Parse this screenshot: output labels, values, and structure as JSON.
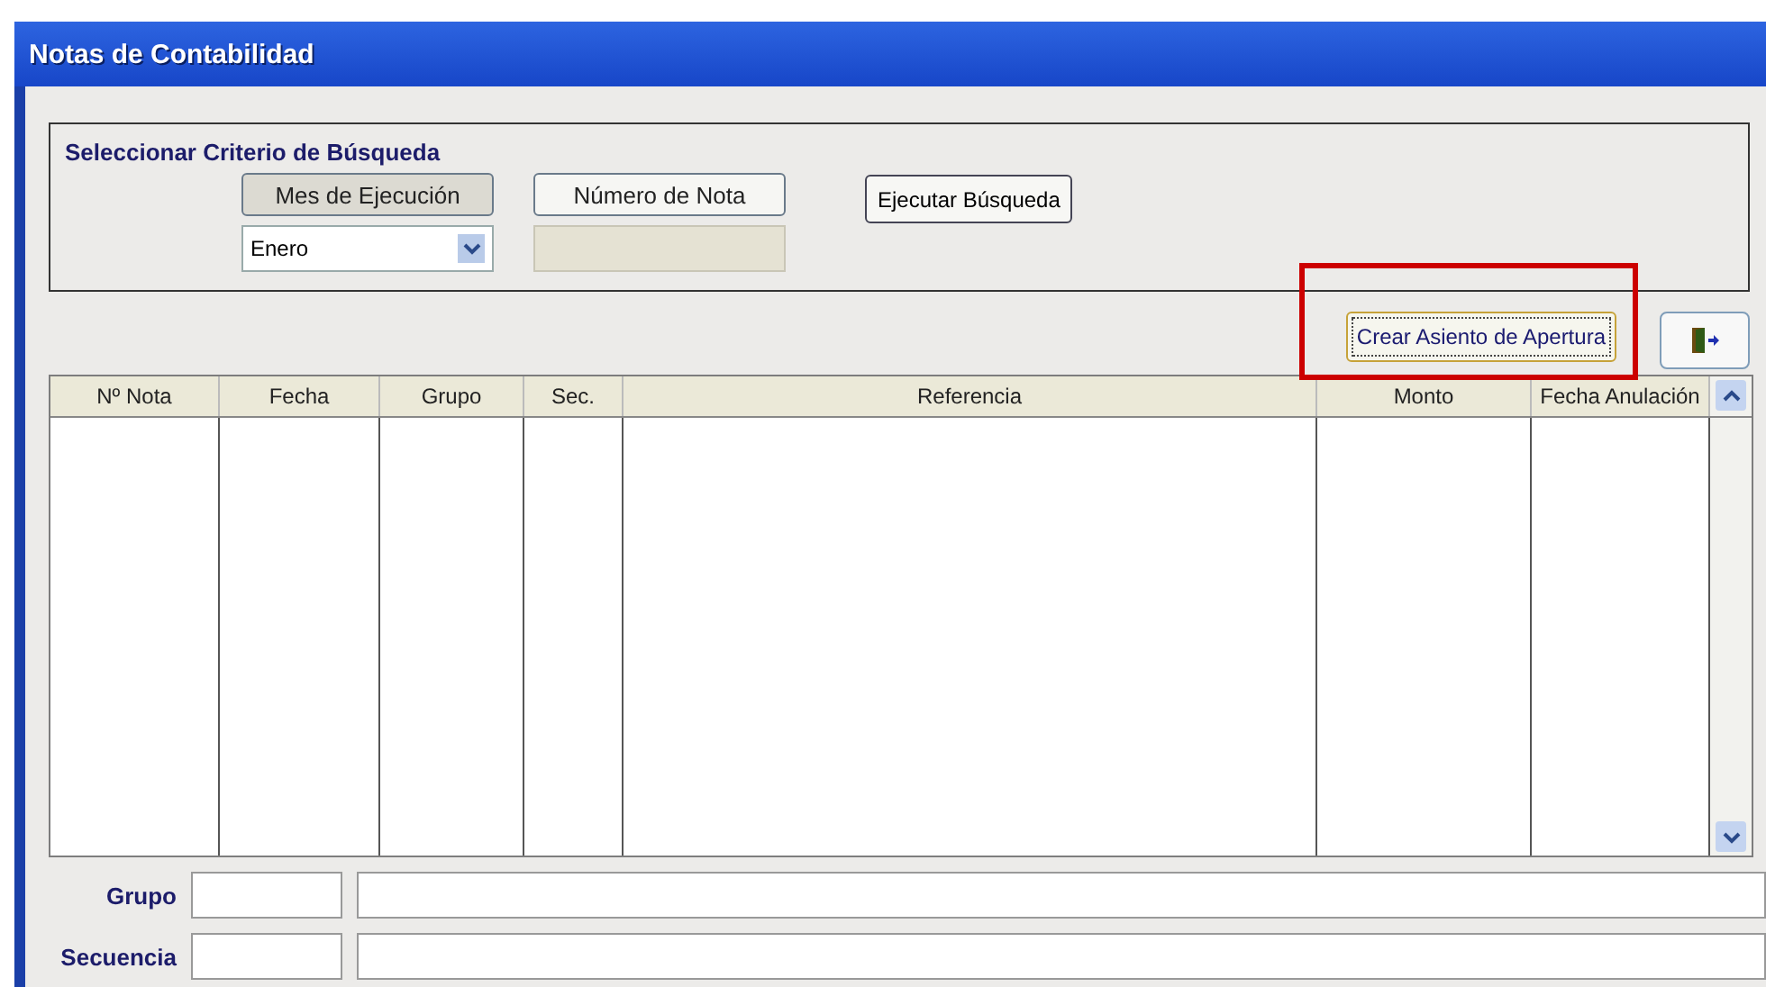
{
  "window": {
    "title": "Notas de Contabilidad"
  },
  "search": {
    "title": "Seleccionar Criterio de Búsqueda",
    "criteria": [
      {
        "label": "Mes de Ejecución",
        "selected": true,
        "kind": "select",
        "value": "Enero"
      },
      {
        "label": "Número de Nota",
        "selected": false,
        "kind": "input"
      }
    ],
    "run_button": "Ejecutar Búsqueda"
  },
  "actions": {
    "create_button": "Crear Asiento de Apertura",
    "create_focused": true
  },
  "table": {
    "columns": [
      "Nº Nota",
      "Fecha",
      "Grupo",
      "Sec.",
      "Referencia",
      "Monto",
      "Fecha Anulación"
    ]
  },
  "footer": {
    "fields": [
      {
        "label": "Grupo"
      },
      {
        "label": "Secuencia"
      }
    ]
  }
}
